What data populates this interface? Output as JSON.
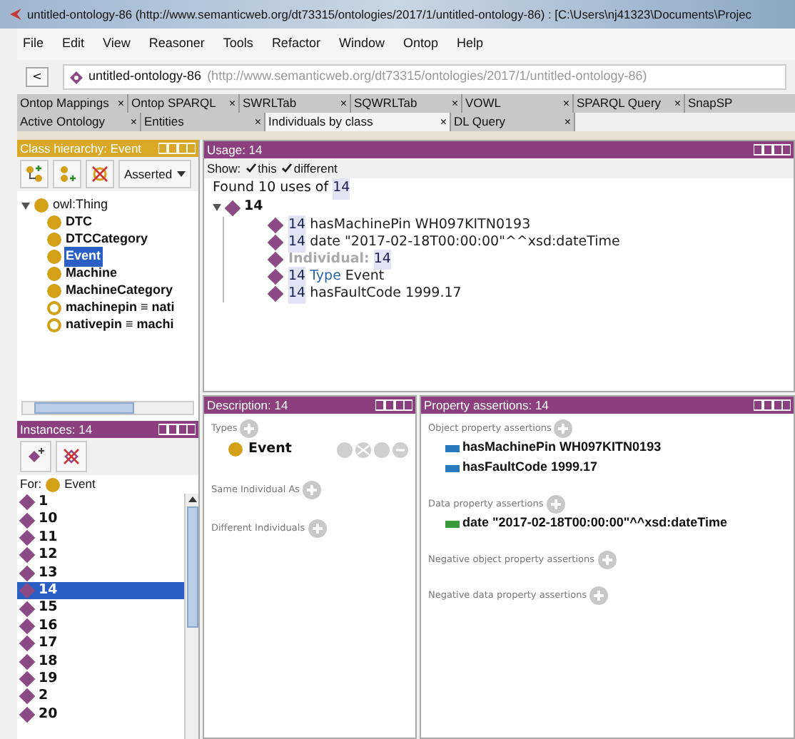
{
  "window": {
    "title": "untitled-ontology-86 (http://www.semanticweb.org/dt73315/ontologies/2017/1/untitled-ontology-86)  : [C:\\Users\\nj41323\\Documents\\Projec"
  },
  "menu": [
    "File",
    "Edit",
    "View",
    "Reasoner",
    "Tools",
    "Refactor",
    "Window",
    "Ontop",
    "Help"
  ],
  "address": {
    "back": "<",
    "name": "untitled-ontology-86",
    "iri": "(http://www.semanticweb.org/dt73315/ontologies/2017/1/untitled-ontology-86)"
  },
  "tab_rows": [
    [
      {
        "label": "Ontop Mappings",
        "close": "×",
        "selected": false
      },
      {
        "label": "Ontop SPARQL",
        "close": "×",
        "selected": false
      },
      {
        "label": "SWRLTab",
        "close": "×",
        "selected": false
      },
      {
        "label": "SQWRLTab",
        "close": "×",
        "selected": false
      },
      {
        "label": "VOWL",
        "close": "×",
        "selected": false
      },
      {
        "label": "SPARQL Query",
        "close": "×",
        "selected": false
      },
      {
        "label": "SnapSP",
        "selected": false
      }
    ],
    [
      {
        "label": "Active Ontology",
        "close": "×",
        "selected": false
      },
      {
        "label": "Entities",
        "close": "×",
        "selected": false
      },
      {
        "label": "Individuals by class",
        "close": "×",
        "selected": true
      },
      {
        "label": "DL Query",
        "close": "×",
        "selected": false
      }
    ]
  ],
  "class_hierarchy": {
    "title": "Class hierarchy: Event",
    "mode": "Asserted",
    "tree": [
      {
        "label": "owl:Thing",
        "kind": "class",
        "expanded": true,
        "selected": false,
        "children": [
          {
            "label": "DTC",
            "kind": "class",
            "selected": false
          },
          {
            "label": "DTCCategory",
            "kind": "class",
            "selected": false
          },
          {
            "label": "Event",
            "kind": "class",
            "selected": true
          },
          {
            "label": "Machine",
            "kind": "class",
            "selected": false
          },
          {
            "label": "MachineCategory",
            "kind": "class",
            "selected": false
          },
          {
            "label": "machinepin ≡ nati",
            "kind": "equivalent",
            "selected": false
          },
          {
            "label": "nativepin ≡ machi",
            "kind": "equivalent",
            "selected": false
          }
        ]
      }
    ]
  },
  "instances": {
    "title": "Instances: 14",
    "for_label": "For:",
    "for_class": "Event",
    "items": [
      {
        "label": "1",
        "selected": false
      },
      {
        "label": "10",
        "selected": false
      },
      {
        "label": "11",
        "selected": false
      },
      {
        "label": "12",
        "selected": false
      },
      {
        "label": "13",
        "selected": false
      },
      {
        "label": "14",
        "selected": true
      },
      {
        "label": "15",
        "selected": false
      },
      {
        "label": "16",
        "selected": false
      },
      {
        "label": "17",
        "selected": false
      },
      {
        "label": "18",
        "selected": false
      },
      {
        "label": "19",
        "selected": false
      },
      {
        "label": "2",
        "selected": false
      },
      {
        "label": "20",
        "selected": false
      }
    ]
  },
  "usage": {
    "title": "Usage: 14",
    "show_label": "Show:",
    "checks": [
      {
        "label": "this",
        "checked": true
      },
      {
        "label": "different",
        "checked": true
      }
    ],
    "found_prefix": "Found 10 uses of",
    "found_entity": "14",
    "root": "14",
    "expanded": true,
    "rows": [
      [
        {
          "text": "14",
          "kind": "entity"
        },
        {
          "text": "hasMachinePin WH097KITN0193",
          "kind": "plain"
        }
      ],
      [
        {
          "text": "14",
          "kind": "entity"
        },
        {
          "text": "date \"2017-02-18T00:00:00\"^^xsd:dateTime",
          "kind": "plain"
        }
      ],
      [
        {
          "text": "Individual:",
          "kind": "muted"
        },
        {
          "text": "14",
          "kind": "entity"
        }
      ],
      [
        {
          "text": "14",
          "kind": "entity"
        },
        {
          "text": "Type",
          "kind": "keyword"
        },
        {
          "text": "Event",
          "kind": "plain"
        }
      ],
      [
        {
          "text": "14",
          "kind": "entity"
        },
        {
          "text": "hasFaultCode 1999.17",
          "kind": "plain"
        }
      ]
    ]
  },
  "description": {
    "title": "Description: 14",
    "sections": [
      {
        "label": "Types",
        "items": [
          {
            "label": "Event"
          }
        ]
      },
      {
        "label": "Same Individual As"
      },
      {
        "label": "Different Individuals"
      }
    ]
  },
  "property_assertions": {
    "title": "Property assertions: 14",
    "sections": [
      {
        "label": "Object property assertions",
        "items": [
          {
            "kind": "object",
            "property": "hasMachinePin",
            "value": "WH097KITN0193"
          },
          {
            "kind": "object",
            "property": "hasFaultCode",
            "value": "1999.17"
          }
        ]
      },
      {
        "label": "Data property assertions",
        "items": [
          {
            "kind": "data",
            "property": "date",
            "value": "\"2017-02-18T00:00:00\"^^xsd:dateTime"
          }
        ]
      },
      {
        "label": "Negative object property assertions"
      },
      {
        "label": "Negative data property assertions"
      }
    ]
  }
}
